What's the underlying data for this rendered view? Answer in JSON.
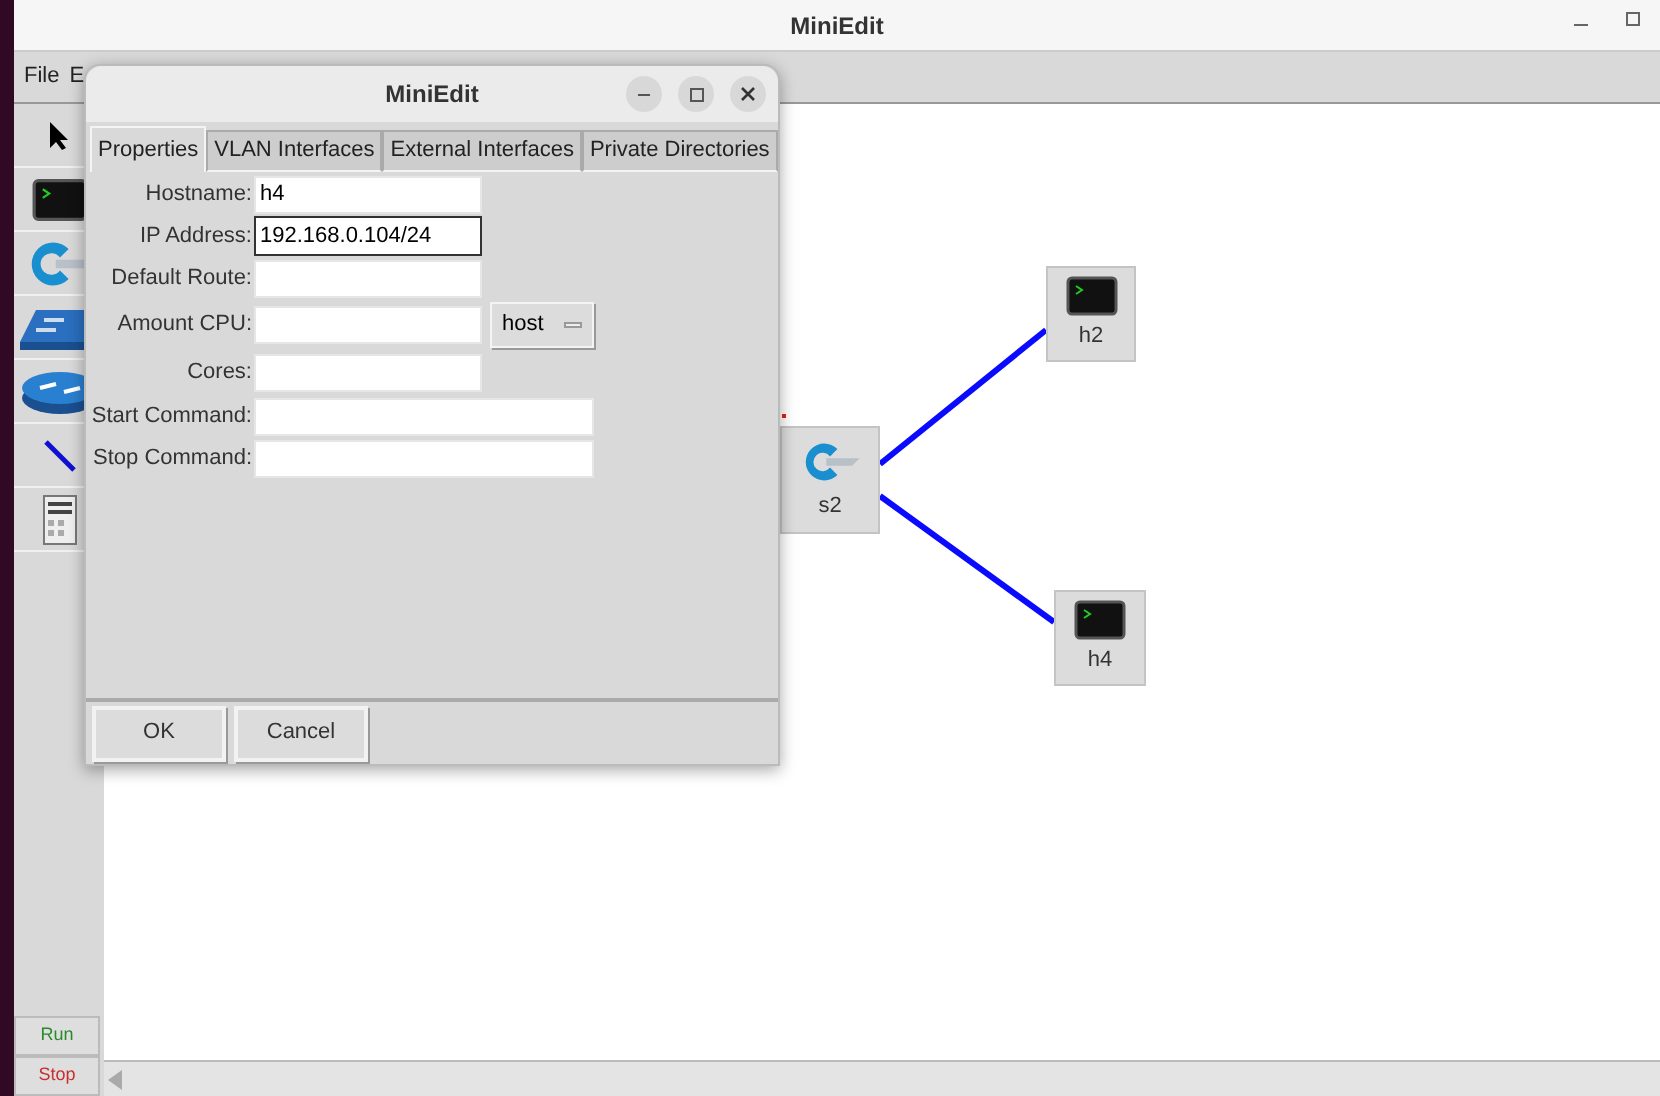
{
  "window": {
    "title": "MiniEdit",
    "menu": [
      "File",
      "E"
    ]
  },
  "toolbar": {
    "tools": [
      {
        "kind": "select"
      },
      {
        "kind": "host"
      },
      {
        "kind": "switch"
      },
      {
        "kind": "legacy-switch"
      },
      {
        "kind": "router"
      },
      {
        "kind": "link"
      },
      {
        "kind": "controller"
      }
    ],
    "run": "Run",
    "stop": "Stop"
  },
  "canvas": {
    "nodes": [
      {
        "kind": "switch",
        "label": "s2"
      },
      {
        "kind": "host",
        "label": "h2",
        "linked": true
      },
      {
        "kind": "host",
        "label": "h4",
        "linked": true
      }
    ]
  },
  "dialog": {
    "title": "MiniEdit",
    "tabs": [
      {
        "label": "Properties",
        "selected": true
      },
      {
        "label": "VLAN Interfaces",
        "selected": false
      },
      {
        "label": "External Interfaces",
        "selected": false
      },
      {
        "label": "Private Directories",
        "selected": false
      }
    ],
    "fields": [
      {
        "label": "Hostname:",
        "value": "h4",
        "kind": "short",
        "focused": false
      },
      {
        "label": "IP Address:",
        "value": "192.168.0.104/24",
        "kind": "short",
        "focused": true
      },
      {
        "label": "Default Route:",
        "kind": "short",
        "focused": false
      },
      {
        "label": "Amount CPU:",
        "kind": "short",
        "focused": false,
        "option": "host"
      },
      {
        "label": "Cores:",
        "kind": "short",
        "focused": false
      },
      {
        "label": "Start Command:",
        "kind": "long",
        "focused": false
      },
      {
        "label": "Stop Command:",
        "kind": "long",
        "focused": false
      }
    ],
    "buttons": [
      "OK",
      "Cancel"
    ]
  }
}
